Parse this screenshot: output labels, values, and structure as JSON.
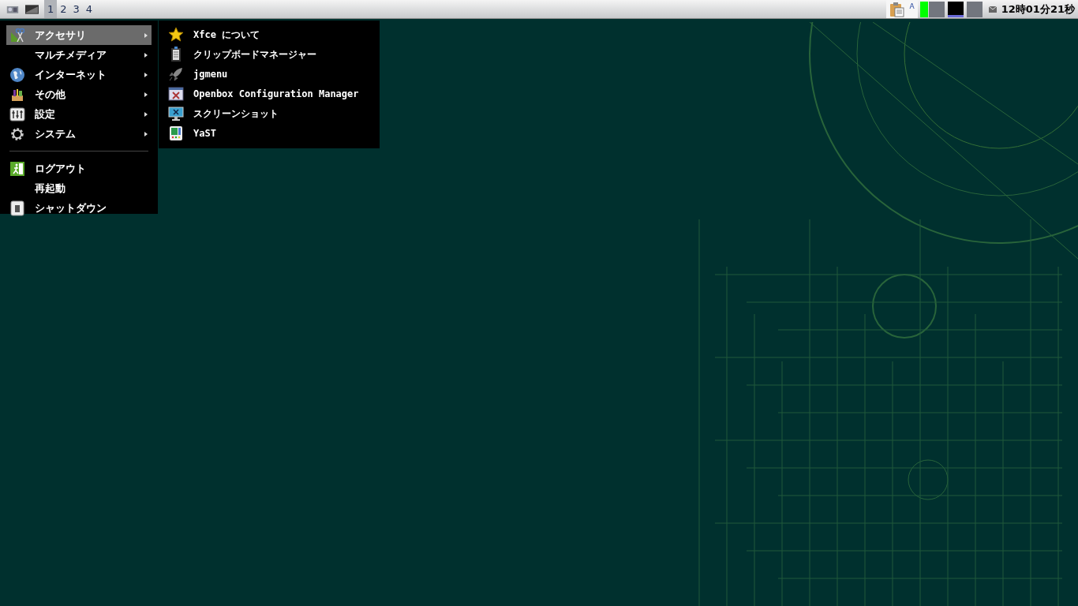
{
  "panel": {
    "workspaces": [
      {
        "label": "1",
        "selected": true
      },
      {
        "label": "2",
        "selected": false
      },
      {
        "label": "3",
        "selected": false
      },
      {
        "label": "4",
        "selected": false
      }
    ],
    "keyboard_indicator": "A",
    "clock": "12時01分21秒"
  },
  "menu": {
    "items": [
      {
        "kind": "item",
        "label": "アクセサリ",
        "submenu": true,
        "selected": true
      },
      {
        "kind": "item",
        "label": "マルチメディア",
        "submenu": true,
        "selected": false
      },
      {
        "kind": "item",
        "label": "インターネット",
        "submenu": true,
        "selected": false
      },
      {
        "kind": "item",
        "label": "その他",
        "submenu": true,
        "selected": false
      },
      {
        "kind": "item",
        "label": "設定",
        "submenu": true,
        "selected": false
      },
      {
        "kind": "item",
        "label": "システム",
        "submenu": true,
        "selected": false
      },
      {
        "kind": "separator"
      },
      {
        "kind": "item",
        "label": "ログアウト",
        "submenu": false,
        "selected": false
      },
      {
        "kind": "item",
        "label": "再起動",
        "submenu": false,
        "selected": false
      },
      {
        "kind": "item",
        "label": "シャットダウン",
        "submenu": false,
        "selected": false
      }
    ]
  },
  "submenu": {
    "items": [
      {
        "label": "Xfce について"
      },
      {
        "label": "クリップボードマネージャー"
      },
      {
        "label": "jgmenu"
      },
      {
        "label": "Openbox Configuration Manager"
      },
      {
        "label": "スクリーンショット"
      },
      {
        "label": "YaST"
      }
    ]
  }
}
